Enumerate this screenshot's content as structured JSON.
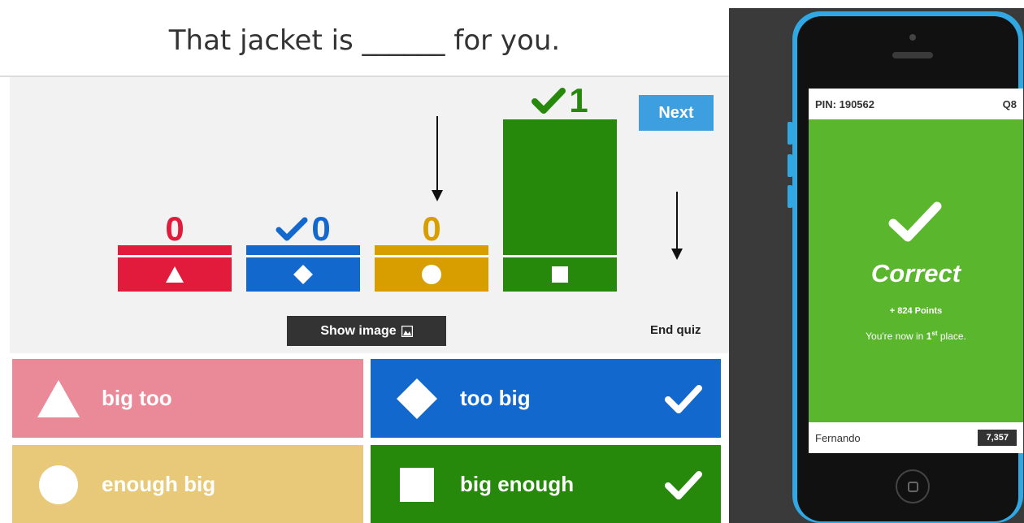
{
  "question": "That jacket is ______ for you.",
  "colors": {
    "red": "#e21b3c",
    "blue": "#1368ce",
    "gold": "#d89e00",
    "green": "#26890c",
    "red_light": "#ea8a99",
    "gold_light": "#e8c979",
    "next_blue": "#3d9ee0",
    "phone_green": "#5ab62d"
  },
  "results": [
    {
      "shape": "triangle-icon",
      "count": "0",
      "correct": false,
      "fraction": 0
    },
    {
      "shape": "diamond-icon",
      "count": "0",
      "correct": true,
      "fraction": 0
    },
    {
      "shape": "circle-icon",
      "count": "0",
      "correct": false,
      "fraction": 0
    },
    {
      "shape": "square-icon",
      "count": "1",
      "correct": true,
      "fraction": 1
    }
  ],
  "controls": {
    "next_label": "Next",
    "show_image_label": "Show image",
    "end_quiz_label": "End quiz"
  },
  "answers": [
    {
      "label": "big too",
      "shape": "triangle-icon",
      "correct": false
    },
    {
      "label": "too big",
      "shape": "diamond-icon",
      "correct": true
    },
    {
      "label": "enough big",
      "shape": "circle-icon",
      "correct": false
    },
    {
      "label": "big enough",
      "shape": "square-icon",
      "correct": true
    }
  ],
  "phone": {
    "pin": "PIN: 190562",
    "question_no": "Q8",
    "status": "Correct",
    "points": "+ 824 Points",
    "place_prefix": "You're now in ",
    "place_num": "1",
    "place_sup": "st",
    "place_suffix": " place.",
    "player": "Fernando",
    "score": "7,357"
  }
}
